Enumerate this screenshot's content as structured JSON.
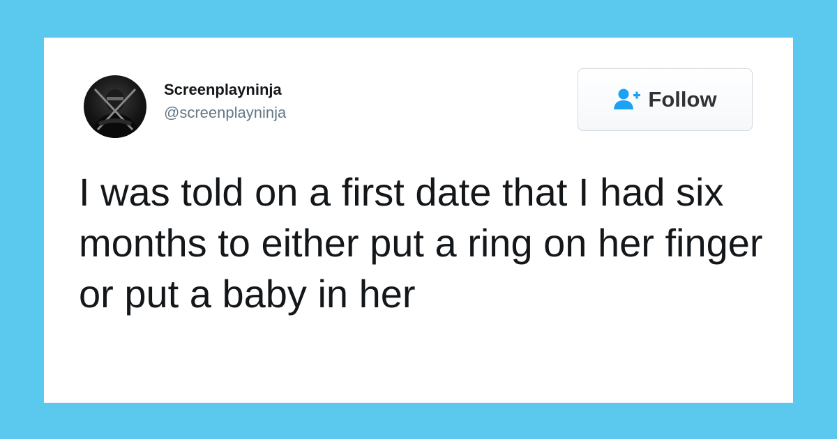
{
  "tweet": {
    "author": {
      "display_name": "Screenplayninja",
      "handle": "@screenplayninja",
      "avatar_icon": "ninja-avatar"
    },
    "follow_button": {
      "label": "Follow",
      "icon": "add-user-icon",
      "icon_color": "#1da1f2"
    },
    "text": "I was told on a first date that I had six months to either put a ring on her finger or put a baby in her"
  },
  "colors": {
    "background": "#5bc8ee",
    "card": "#ffffff",
    "text": "#14171a",
    "handle": "#657786"
  }
}
